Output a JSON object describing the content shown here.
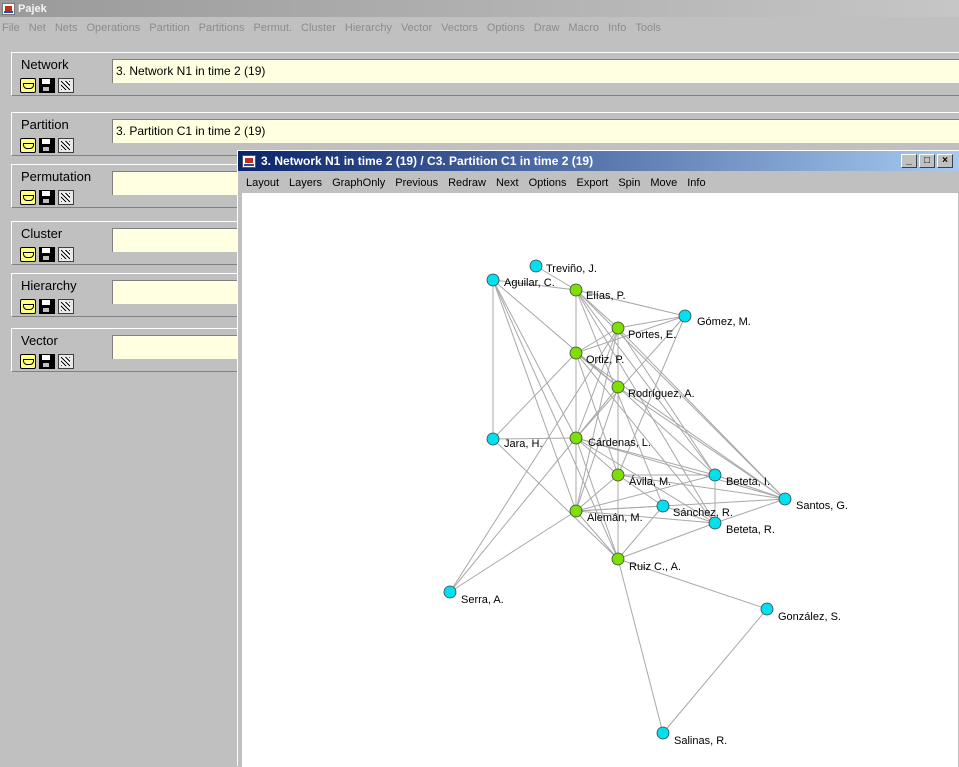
{
  "app": {
    "title": "Pajek"
  },
  "menubar": [
    "File",
    "Net",
    "Nets",
    "Operations",
    "Partition",
    "Partitions",
    "Permut.",
    "Cluster",
    "Hierarchy",
    "Vector",
    "Vectors",
    "Options",
    "Draw",
    "Macro",
    "Info",
    "Tools"
  ],
  "panels": [
    {
      "label": "Network",
      "value": "3. Network N1 in time 2 (19)"
    },
    {
      "label": "Partition",
      "value": "3. Partition C1 in time 2 (19)"
    },
    {
      "label": "Permutation",
      "value": ""
    },
    {
      "label": "Cluster",
      "value": ""
    },
    {
      "label": "Hierarchy",
      "value": ""
    },
    {
      "label": "Vector",
      "value": ""
    }
  ],
  "graph_window": {
    "title": "3. Network N1 in time 2 (19) / C3. Partition C1 in time 2 (19)",
    "menu": [
      "Layout",
      "Layers",
      "GraphOnly",
      "Previous",
      "Redraw",
      "Next",
      "Options",
      "Export",
      "Spin",
      "Move",
      "Info"
    ]
  },
  "colors": {
    "cluster_green": "#7ee000",
    "cluster_cyan": "#00e0f0",
    "edge": "#a8a8a8"
  },
  "graph": {
    "nodes": [
      {
        "id": "trevino",
        "label": "Treviño, J.",
        "color": "cyan"
      },
      {
        "id": "aguilar",
        "label": "Aguilar, C.",
        "color": "cyan"
      },
      {
        "id": "elias",
        "label": "Elías, P.",
        "color": "green"
      },
      {
        "id": "gomez",
        "label": "Gómez, M.",
        "color": "cyan"
      },
      {
        "id": "portes",
        "label": "Portes, E.",
        "color": "green"
      },
      {
        "id": "ortiz",
        "label": "Ortiz, P.",
        "color": "green"
      },
      {
        "id": "rodriguez",
        "label": "Rodríguez, A.",
        "color": "green"
      },
      {
        "id": "jara",
        "label": "Jara, H.",
        "color": "cyan"
      },
      {
        "id": "cardenas",
        "label": "Cárdenas, L.",
        "color": "green"
      },
      {
        "id": "avila",
        "label": "Ávila, M.",
        "color": "green"
      },
      {
        "id": "betetai",
        "label": "Beteta, I.",
        "color": "cyan"
      },
      {
        "id": "santos",
        "label": "Santos, G.",
        "color": "cyan"
      },
      {
        "id": "sanchez",
        "label": "Sánchez, R.",
        "color": "cyan"
      },
      {
        "id": "aleman",
        "label": "Alemán, M.",
        "color": "green"
      },
      {
        "id": "betetar",
        "label": "Beteta, R.",
        "color": "cyan"
      },
      {
        "id": "ruiz",
        "label": "Ruiz C., A.",
        "color": "green"
      },
      {
        "id": "serra",
        "label": "Serra, A.",
        "color": "cyan"
      },
      {
        "id": "gonzalez",
        "label": "González, S.",
        "color": "cyan"
      },
      {
        "id": "salinas",
        "label": "Salinas, R.",
        "color": "cyan"
      }
    ],
    "edges": [
      [
        "trevino",
        "elias"
      ],
      [
        "aguilar",
        "elias"
      ],
      [
        "aguilar",
        "jara"
      ],
      [
        "aguilar",
        "aleman"
      ],
      [
        "aguilar",
        "cardenas"
      ],
      [
        "aguilar",
        "rodriguez"
      ],
      [
        "aguilar",
        "ruiz"
      ],
      [
        "elias",
        "portes"
      ],
      [
        "elias",
        "gomez"
      ],
      [
        "elias",
        "ortiz"
      ],
      [
        "elias",
        "cardenas"
      ],
      [
        "elias",
        "betetai"
      ],
      [
        "elias",
        "santos"
      ],
      [
        "elias",
        "sanchez"
      ],
      [
        "elias",
        "betetar"
      ],
      [
        "gomez",
        "portes"
      ],
      [
        "gomez",
        "ortiz"
      ],
      [
        "gomez",
        "avila"
      ],
      [
        "gomez",
        "cardenas"
      ],
      [
        "portes",
        "ortiz"
      ],
      [
        "portes",
        "rodriguez"
      ],
      [
        "portes",
        "cardenas"
      ],
      [
        "portes",
        "aleman"
      ],
      [
        "portes",
        "betetai"
      ],
      [
        "portes",
        "santos"
      ],
      [
        "portes",
        "serra"
      ],
      [
        "ortiz",
        "rodriguez"
      ],
      [
        "ortiz",
        "cardenas"
      ],
      [
        "ortiz",
        "aleman"
      ],
      [
        "ortiz",
        "santos"
      ],
      [
        "ortiz",
        "betetar"
      ],
      [
        "ortiz",
        "avila"
      ],
      [
        "ortiz",
        "jara"
      ],
      [
        "rodriguez",
        "cardenas"
      ],
      [
        "rodriguez",
        "aleman"
      ],
      [
        "rodriguez",
        "santos"
      ],
      [
        "rodriguez",
        "avila"
      ],
      [
        "rodriguez",
        "betetai"
      ],
      [
        "jara",
        "cardenas"
      ],
      [
        "jara",
        "ruiz"
      ],
      [
        "cardenas",
        "avila"
      ],
      [
        "cardenas",
        "aleman"
      ],
      [
        "cardenas",
        "ruiz"
      ],
      [
        "cardenas",
        "betetai"
      ],
      [
        "cardenas",
        "santos"
      ],
      [
        "cardenas",
        "betetar"
      ],
      [
        "cardenas",
        "serra"
      ],
      [
        "avila",
        "betetai"
      ],
      [
        "avila",
        "aleman"
      ],
      [
        "avila",
        "ruiz"
      ],
      [
        "avila",
        "santos"
      ],
      [
        "avila",
        "sanchez"
      ],
      [
        "betetai",
        "santos"
      ],
      [
        "betetai",
        "betetar"
      ],
      [
        "betetai",
        "aleman"
      ],
      [
        "santos",
        "aleman"
      ],
      [
        "santos",
        "betetar"
      ],
      [
        "sanchez",
        "aleman"
      ],
      [
        "sanchez",
        "ruiz"
      ],
      [
        "sanchez",
        "betetar"
      ],
      [
        "aleman",
        "ruiz"
      ],
      [
        "aleman",
        "serra"
      ],
      [
        "aleman",
        "betetar"
      ],
      [
        "ruiz",
        "gonzalez"
      ],
      [
        "ruiz",
        "salinas"
      ],
      [
        "ruiz",
        "betetar"
      ],
      [
        "gonzalez",
        "salinas"
      ]
    ]
  }
}
